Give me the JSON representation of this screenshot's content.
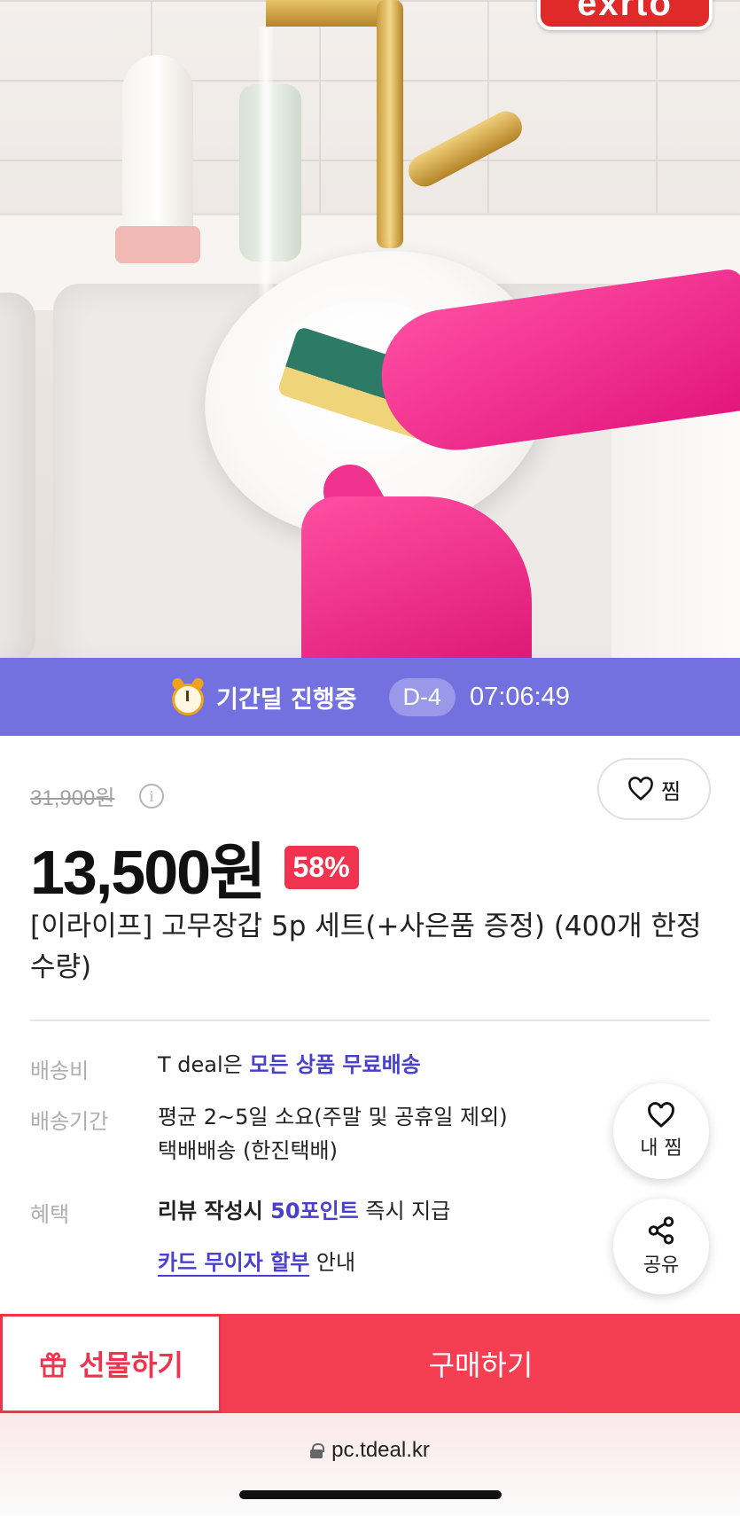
{
  "hero": {
    "brand_logo_text": "exrto"
  },
  "deal_banner": {
    "label": "기간딜 진행중",
    "d_day": "D-4",
    "countdown": "07:06:49",
    "bg_color": "#7371e0"
  },
  "product": {
    "original_price": "31,900원",
    "sale_price": "13,500원",
    "discount": "58%",
    "title": "[이라이프] 고무장갑 5p 세트(+사은품 증정) (400개 한정 수량)",
    "wish_label": "찜"
  },
  "details": {
    "shipping_fee": {
      "label": "배송비",
      "prefix": "T deal은 ",
      "highlight": "모든 상품 무료배송"
    },
    "shipping_period": {
      "label": "배송기간",
      "line1": "평균 2~5일 소요(주말 및 공휴일 제외)",
      "line2": "택배배송 (한진택배)"
    },
    "benefit": {
      "label": "혜택",
      "review_prefix": "리뷰 작성시 ",
      "review_points": "50포인트",
      "review_suffix": " 즉시 지급",
      "card_link": "카드 무이자 할부",
      "card_suffix": " 안내"
    }
  },
  "floating": {
    "my_wish_label": "내 찜",
    "share_label": "공유"
  },
  "bottom_bar": {
    "gift_label": "선물하기",
    "buy_label": "구매하기",
    "accent_color": "#f53e51"
  },
  "browser": {
    "url": "pc.tdeal.kr"
  }
}
